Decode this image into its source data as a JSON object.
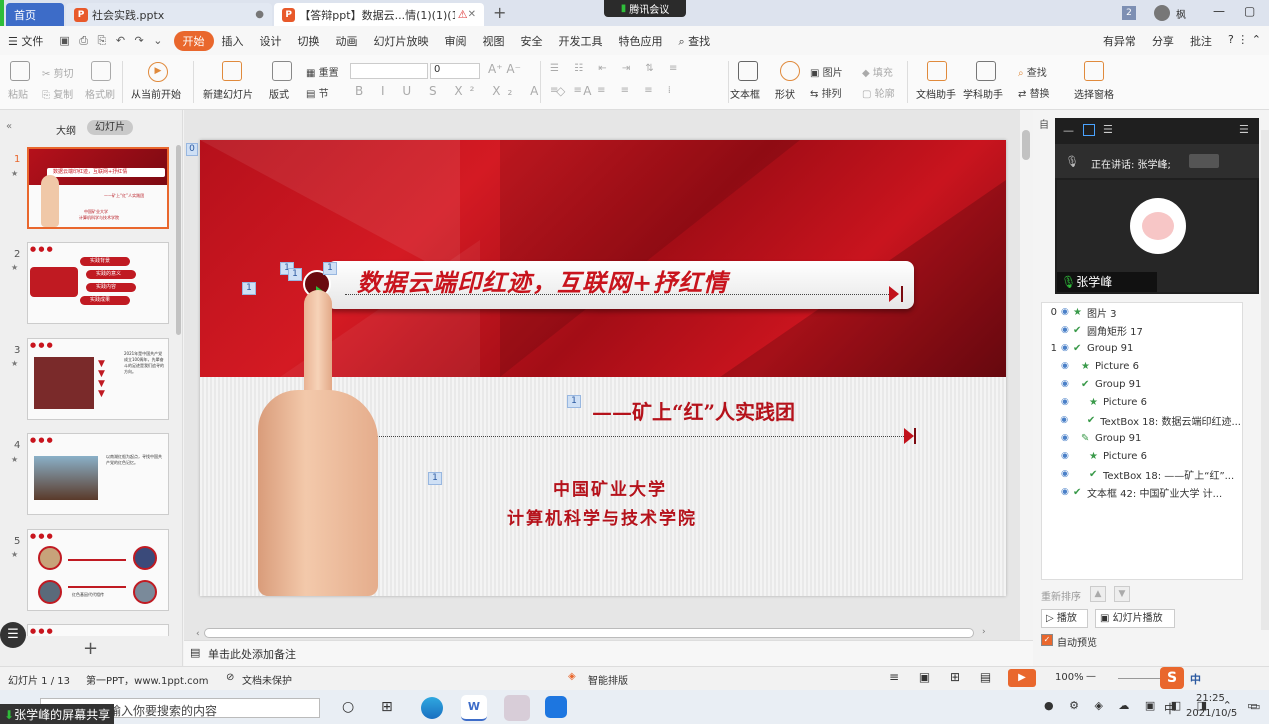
{
  "tabs": {
    "home": "首页",
    "file1": "社会实践.pptx",
    "file2": "【答辩ppt】数据云...情(1)(1)(1)",
    "new": "+"
  },
  "meeting": {
    "label": "腾讯会议"
  },
  "window": {
    "badge": "2",
    "user": "枫"
  },
  "menu": {
    "file": "文件",
    "items": [
      "开始",
      "插入",
      "设计",
      "切换",
      "动画",
      "幻灯片放映",
      "审阅",
      "视图",
      "安全",
      "开发工具",
      "特色应用"
    ],
    "search": "查找",
    "right": [
      "有异常",
      "分享",
      "批注"
    ]
  },
  "ribbon": {
    "paste": "粘贴",
    "cut": "剪切",
    "copy": "复制",
    "format_painter": "格式刷",
    "from_start": "从当前开始",
    "new_slide": "新建幻灯片",
    "layout": "版式",
    "reset": "重置",
    "section": "节",
    "font_size": "0",
    "picture": "图片",
    "fill": "填充",
    "outline": "轮廓",
    "shape": "形状",
    "arrange": "排列",
    "textbox": "文本框",
    "doc_helper": "文档助手",
    "subject_helper": "学科助手",
    "find": "查找",
    "replace": "替换",
    "select_pane": "选择窗格"
  },
  "leftpanel": {
    "tab_outline": "大纲",
    "tab_slides": "幻灯片",
    "slide_nums": [
      "1",
      "2",
      "3",
      "4",
      "5"
    ]
  },
  "slide": {
    "title": "数据云端印红迹，互联网+抒红情",
    "subtitle": "——矿上“红”人实践团",
    "school": "中国矿业大学",
    "college": "计算机科学与技术学院",
    "badge": "1",
    "corner": "0"
  },
  "thumbs": {
    "t1_title": "数据云端印红迹，互联网+抒红情",
    "t1_sub": "——矿上“红”人实践团",
    "t2_items": [
      "实践背景",
      "实践的意义",
      "实践内容",
      "实践成果"
    ],
    "t3_text": "2021年是中国共产党成立100周年，先辈奋斗的足迹是我们追寻的方向。",
    "t4_text": "以南湖红船为起点，寻找中国共产党的红色记忆。",
    "t5_text": "红色基因代代相传"
  },
  "notes": {
    "placeholder": "单击此处添加备注"
  },
  "rightpanel": {
    "auto": "自",
    "speaker": "正在讲话: 张学峰;",
    "presenter": "张学峰",
    "reorder": "重新排序",
    "play": "播放",
    "slideshow": "幻灯片播放",
    "auto_preview": "自动预览"
  },
  "selection": [
    {
      "num": "0",
      "name": "图片 3"
    },
    {
      "num": "",
      "name": "圆角矩形 17"
    },
    {
      "num": "1",
      "name": "Group 91"
    },
    {
      "num": "",
      "name": "Picture 6"
    },
    {
      "num": "",
      "name": "Group 91"
    },
    {
      "num": "",
      "name": "Picture 6"
    },
    {
      "num": "",
      "name": "TextBox 18: 数据云端印红迹..."
    },
    {
      "num": "",
      "name": "Group 91"
    },
    {
      "num": "",
      "name": "Picture 6"
    },
    {
      "num": "",
      "name": "TextBox 18: ——矿上“红”..."
    },
    {
      "num": "",
      "name": "文本框 42: 中国矿业大学 计..."
    }
  ],
  "status": {
    "slide": "幻灯片 1 / 13",
    "theme": "第一PPT，www.1ppt.com",
    "protect": "文档未保护",
    "smart": "智能排版",
    "zoom": "100%"
  },
  "taskbar": {
    "share": "张学峰的屏幕共享",
    "search": "在这里输入你要搜索的内容",
    "ime": "中",
    "time": "21:25",
    "date": "2021/10/5"
  }
}
